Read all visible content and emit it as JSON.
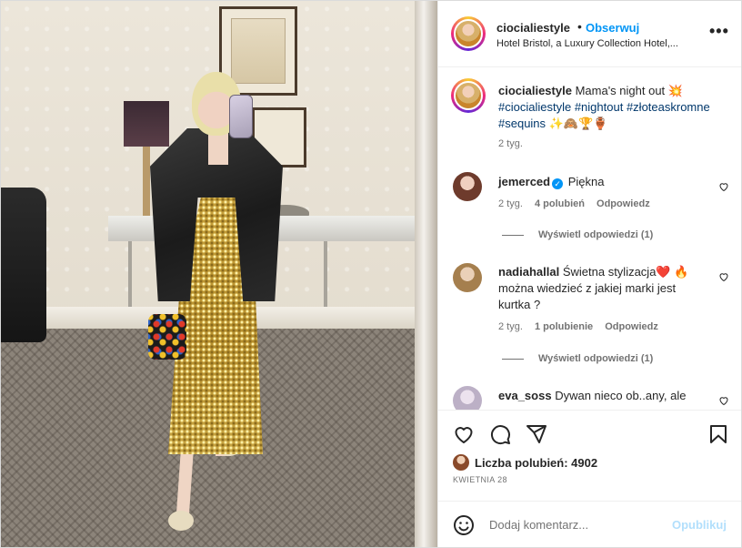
{
  "post": {
    "username": "ciocialiestyle",
    "separator": "•",
    "follow_label": "Obserwuj",
    "location": "Hotel Bristol, a Luxury Collection Hotel,...",
    "more_label": "•••"
  },
  "caption": {
    "username": "ciocialiestyle",
    "text": "Mama's night out 💥",
    "hashtags": [
      "#ciocialiestyle",
      "#nightout",
      "#złoteaskromne",
      "#sequins"
    ],
    "emojis": "✨🙈🏆🏺",
    "time": "2 tyg."
  },
  "comments": [
    {
      "username": "jemerced",
      "verified": true,
      "text": "Piękna",
      "time": "2 tyg.",
      "likes": "4 polubień",
      "reply_label": "Odpowiedz",
      "view_replies": "Wyświetl odpowiedzi (1)",
      "avatar_color": "#c98a7a"
    },
    {
      "username": "nadiahallal",
      "verified": false,
      "text": "Świetna stylizacja❤️ 🔥 można wiedzieć z jakiej marki jest kurtka ?",
      "time": "2 tyg.",
      "likes": "1 polubienie",
      "reply_label": "Odpowiedz",
      "view_replies": "Wyświetl odpowiedzi (1)",
      "avatar_color": "#b8925a"
    },
    {
      "username": "eva_soss",
      "verified": false,
      "text": "Dywan nieco ob..any, ale",
      "avatar_color": "#cfc7d6"
    }
  ],
  "actions": {
    "likes_label": "Liczba polubień: 4902",
    "date": "KWIETNIA 28"
  },
  "add_comment": {
    "placeholder": "Dodaj komentarz...",
    "post_label": "Opublikuj"
  },
  "colors": {
    "link": "#00376b",
    "accent": "#0095f6",
    "muted": "#737373",
    "post_disabled": "#b2dffc"
  }
}
